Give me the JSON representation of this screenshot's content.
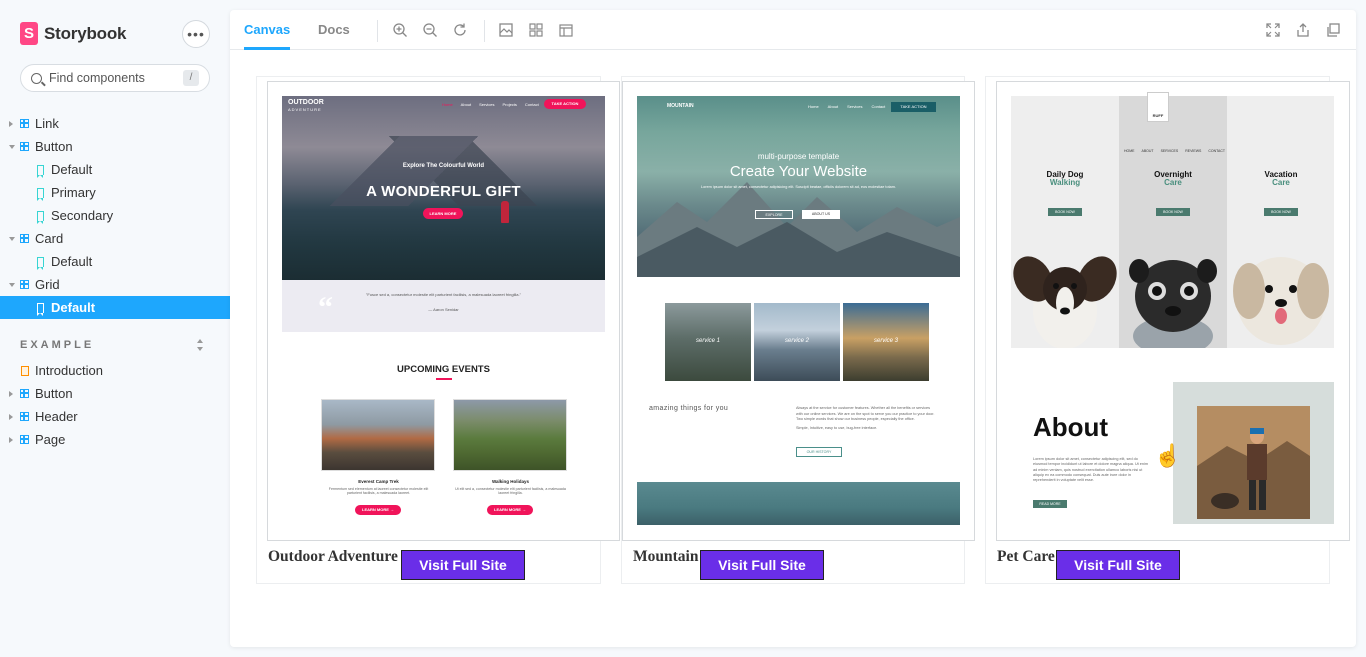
{
  "app": {
    "name": "Storybook",
    "logo_letter": "S",
    "menu_label": "•••"
  },
  "search": {
    "placeholder": "Find components",
    "shortcut": "/"
  },
  "sidebar": {
    "tree": [
      {
        "label": "Link",
        "type": "component",
        "expanded": false
      },
      {
        "label": "Button",
        "type": "component",
        "expanded": true
      },
      {
        "label": "Default",
        "type": "story"
      },
      {
        "label": "Primary",
        "type": "story"
      },
      {
        "label": "Secondary",
        "type": "story"
      },
      {
        "label": "Card",
        "type": "component",
        "expanded": true
      },
      {
        "label": "Default",
        "type": "story"
      },
      {
        "label": "Grid",
        "type": "component",
        "expanded": true
      },
      {
        "label": "Default",
        "type": "story",
        "selected": true
      }
    ],
    "group_title": "EXAMPLE",
    "group_items": [
      {
        "label": "Introduction",
        "type": "doc"
      },
      {
        "label": "Button",
        "type": "component"
      },
      {
        "label": "Header",
        "type": "component"
      },
      {
        "label": "Page",
        "type": "component"
      }
    ]
  },
  "toolbar": {
    "tabs": [
      "Canvas",
      "Docs"
    ],
    "active_tab": "Canvas",
    "tools": [
      "zoom-in-icon",
      "zoom-out-icon",
      "zoom-reset-icon",
      "background-icon",
      "grid-icon",
      "measure-icon"
    ],
    "right_tools": [
      "fullscreen-icon",
      "share-icon",
      "copy-link-icon"
    ]
  },
  "cards": [
    {
      "title": "Outdoor Adventure",
      "button": "Visit Full Site",
      "site": {
        "logo": "OUTDOOR",
        "logo_sub": "ADVENTURE",
        "nav": [
          "Home",
          "About",
          "Services",
          "Projects",
          "Contact"
        ],
        "cta": "TAKE ACTION",
        "subtitle": "Explore The Colourful World",
        "headline": "A WONDERFUL GIFT",
        "hero_btn": "LEARN MORE",
        "quote": "\"Fusce sed a, consectetur molestie elit parturient facilisis, a malesuada laoreet fringilla.\"",
        "quote_author": "— Aaron Senidar",
        "events_title": "UPCOMING EVENTS",
        "events": [
          {
            "name": "Everest Camp Trek",
            "text": "Fermentum sed elementum at laoreet consectetur molestie elit parturient facilisis, a malesuada laoreet.",
            "btn": "LEARN MORE →"
          },
          {
            "name": "Walking Holidays",
            "text": "Ut elit sed a, consectetur molestie elit parturient facilisis, a malesuada laoreet fringilla.",
            "btn": "LEARN MORE →"
          }
        ]
      }
    },
    {
      "title": "Mountain",
      "button": "Visit Full Site",
      "site": {
        "logo": "MOUNTAIN",
        "nav": [
          "Home",
          "About",
          "Services",
          "Contact"
        ],
        "cta": "TAKE ACTION",
        "subtitle": "multi-purpose template",
        "headline": "Create Your Website",
        "text": "Lorem ipsum dolor sit amet, consectetur adipisicing elit. Suscipit beatae, officiis dolorem sit ad, eos molestiae totam.",
        "btn1": "EXPLORE",
        "btn2": "ABOUT US",
        "services": [
          "service 1",
          "service 2",
          "service 3"
        ],
        "amazing": "amazing things for you",
        "para": "Always at the service for customer features. Whether all the benefits or services with our online services. We are on the spot to serve you our practice to your door. Two simple words that show our business people, especially the office.",
        "para2": "Simple, Intuitive, easy to use, bug-free interface.",
        "learn": "OUR HISTORY"
      }
    },
    {
      "title": "Pet Care",
      "button": "Visit Full Site",
      "site": {
        "logo": "RUFF",
        "nav": [
          "HOME",
          "ABOUT",
          "SERVICES",
          "REVIEWS",
          "CONTACT"
        ],
        "columns": [
          {
            "title": "Daily Dog",
            "sub": "Walking",
            "btn": "BOOK NOW"
          },
          {
            "title": "Overnight",
            "sub": "Care",
            "btn": "BOOK NOW"
          },
          {
            "title": "Vacation",
            "sub": "Care",
            "btn": "BOOK NOW"
          }
        ],
        "about_title": "About",
        "about_text": "Lorem ipsum dolor sit amet, consectetur adipiscing elit, sed do eiusmod tempor incididunt ut labore et dolore magna aliqua. Ut enim ad minim veniam, quis nostrud exercitation ullamco laboris nisi ut aliquip ex ea commodo consequat. Duis aute irure dolor in reprehenderit in voluptate velit esse.",
        "about_btn": "READ MORE"
      }
    }
  ],
  "colors": {
    "accent": "#1ea7fd",
    "brand": "#ff4785",
    "visit_button": "#6a2ee8",
    "outdoor_pink": "#f0145a",
    "mountain_teal": "#1a5e67",
    "petcare_green": "#4a7a6e"
  }
}
